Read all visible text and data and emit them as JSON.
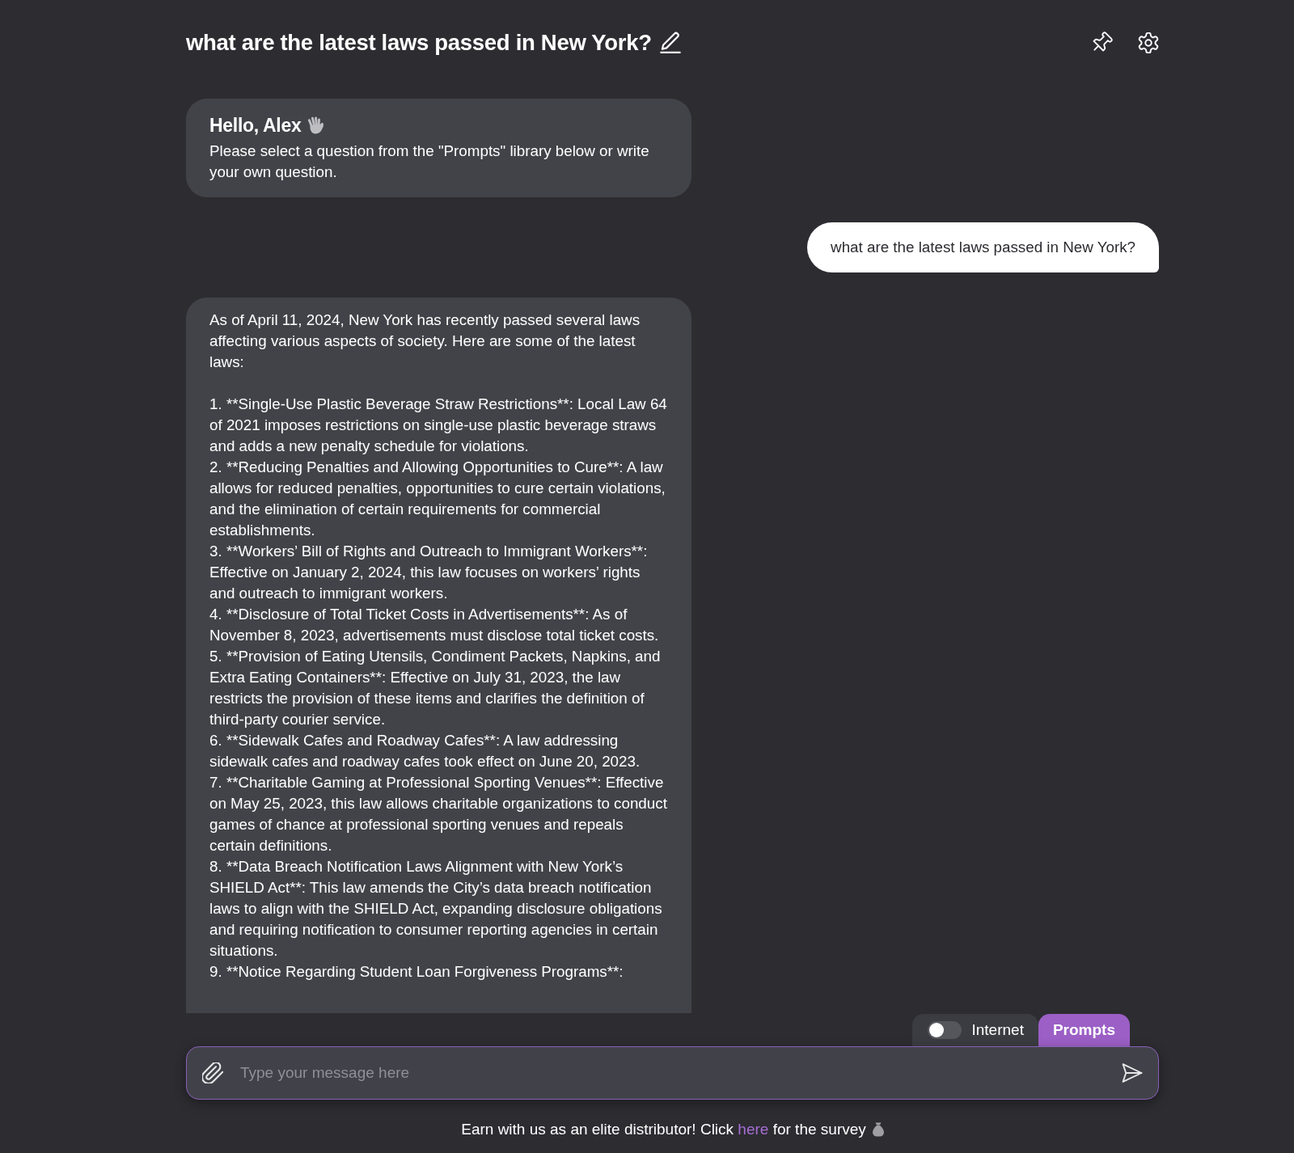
{
  "header": {
    "title": "what are the latest laws passed in New York?"
  },
  "messages": [
    {
      "kind": "greeting",
      "title": "Hello, Alex",
      "text": "Please select a question from the \"Prompts\" library below or write your own question."
    },
    {
      "kind": "user",
      "text": "what are the latest laws passed in New York?"
    },
    {
      "kind": "answer",
      "intro": "As of April 11, 2024, New York has recently passed several laws affecting various aspects of society. Here are some of the latest laws:",
      "items": [
        "1. **Single-Use Plastic Beverage Straw Restrictions**: Local Law 64 of 2021 imposes restrictions on single-use plastic beverage straws and adds a new penalty schedule for violations.",
        "2. **Reducing Penalties and Allowing Opportunities to Cure**: A law allows for reduced penalties, opportunities to cure certain violations, and the elimination of certain requirements for commercial establishments.",
        "3. **Workers’ Bill of Rights and Outreach to Immigrant Workers**: Effective on January 2, 2024, this law focuses on workers’ rights and outreach to immigrant workers.",
        "4. **Disclosure of Total Ticket Costs in Advertisements**: As of November 8, 2023, advertisements must disclose total ticket costs.",
        "5. **Provision of Eating Utensils, Condiment Packets, Napkins, and Extra Eating Containers**: Effective on July 31, 2023, the law restricts the provision of these items and clarifies the definition of third-party courier service.",
        "6. **Sidewalk Cafes and Roadway Cafes**: A law addressing sidewalk cafes and roadway cafes took effect on June 20, 2023.",
        "7. **Charitable Gaming at Professional Sporting Venues**: Effective on May 25, 2023, this law allows charitable organizations to conduct games of chance at professional sporting venues and repeals certain definitions.",
        "8. **Data Breach Notification Laws Alignment with New York’s SHIELD Act**: This law amends the City’s data breach notification laws to align with the SHIELD Act, expanding disclosure obligations and requiring notification to consumer reporting agencies in certain situations.",
        "9. **Notice Regarding Student Loan Forgiveness Programs**:"
      ]
    }
  ],
  "composer": {
    "internet": {
      "label": "Internet",
      "on": false
    },
    "prompts": {
      "label": "Prompts"
    },
    "placeholder": "Type your message here"
  },
  "footer": {
    "text": "Earn with us as an elite distributor! Click",
    "link": "here",
    "text_after": "for the survey"
  }
}
